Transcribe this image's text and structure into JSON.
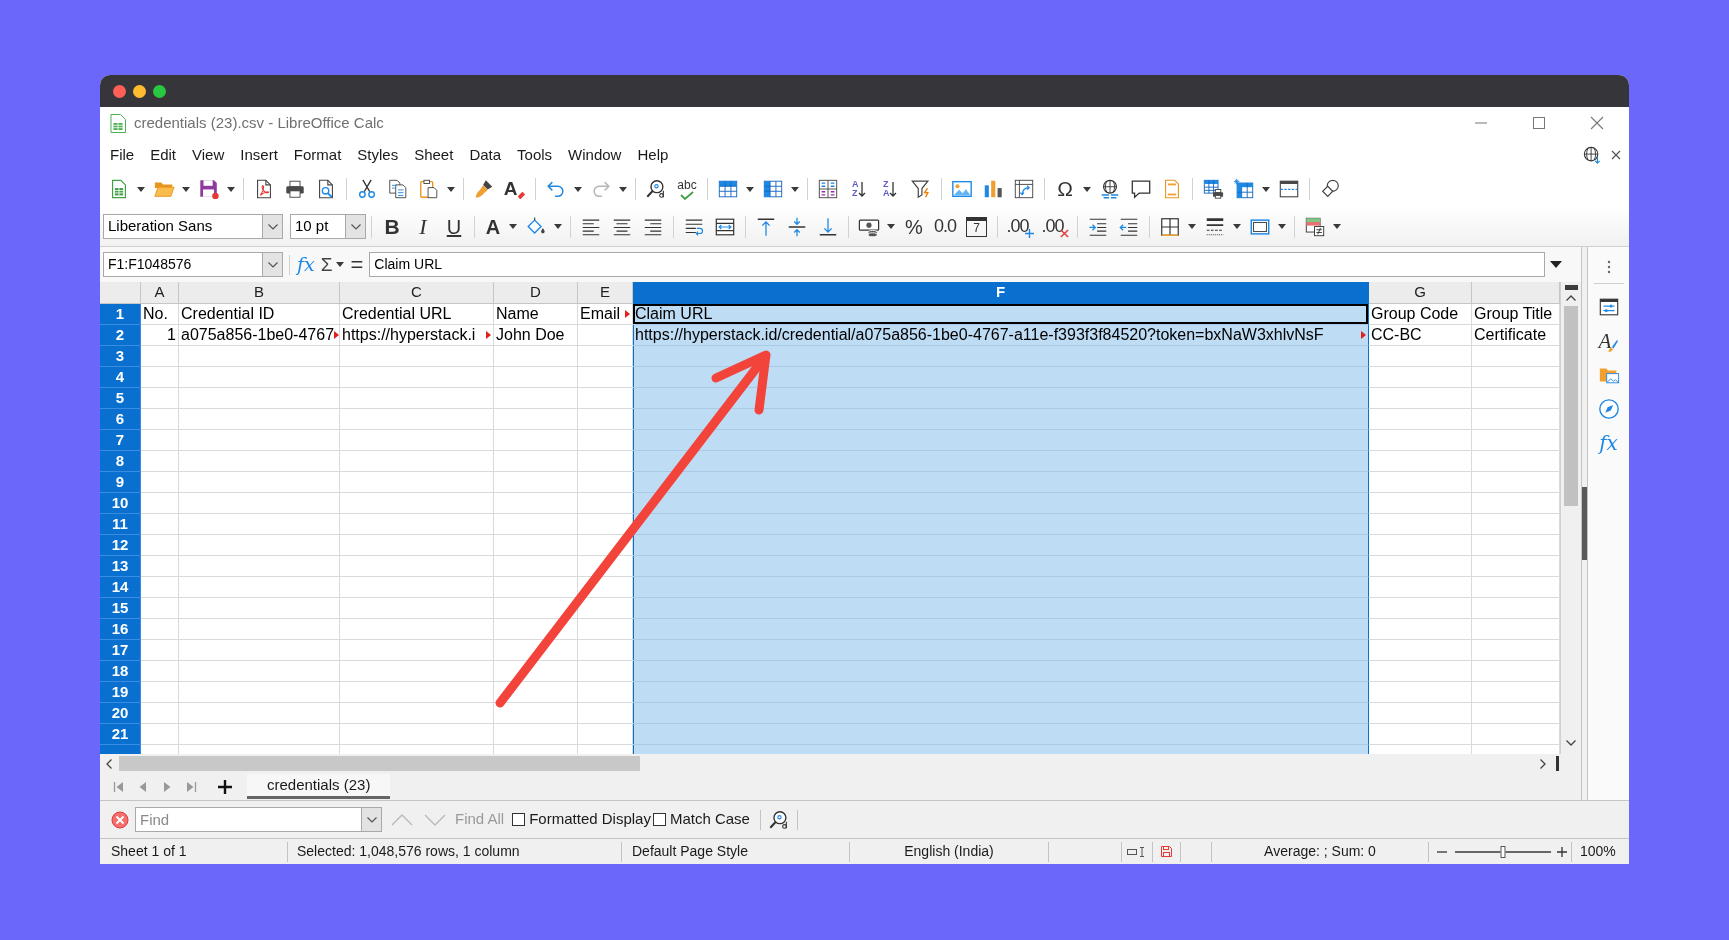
{
  "window": {
    "title": "credentials (23).csv - LibreOffice Calc"
  },
  "menu": [
    "File",
    "Edit",
    "View",
    "Insert",
    "Format",
    "Styles",
    "Sheet",
    "Data",
    "Tools",
    "Window",
    "Help"
  ],
  "standard_toolbar": [
    [
      {
        "kind": "new",
        "dropdown": true,
        "disabled": false
      },
      {
        "kind": "open",
        "dropdown": true,
        "disabled": false
      },
      {
        "kind": "save",
        "dropdown": true,
        "disabled": false
      }
    ],
    [
      {
        "kind": "export_pdf",
        "dropdown": false,
        "disabled": false
      },
      {
        "kind": "print",
        "dropdown": false,
        "disabled": false
      },
      {
        "kind": "print_preview",
        "dropdown": false,
        "disabled": false
      }
    ],
    [
      {
        "kind": "cut",
        "dropdown": false,
        "disabled": false
      },
      {
        "kind": "copy",
        "dropdown": false,
        "disabled": false
      },
      {
        "kind": "paste",
        "dropdown": true,
        "disabled": false
      }
    ],
    [
      {
        "kind": "clone",
        "dropdown": false,
        "disabled": false
      },
      {
        "kind": "clear_formatting",
        "label": "A",
        "dropdown": false,
        "disabled": false
      }
    ],
    [
      {
        "kind": "undo",
        "dropdown": true,
        "disabled": false
      },
      {
        "kind": "redo",
        "dropdown": true,
        "disabled": true
      }
    ],
    [
      {
        "kind": "find_replace",
        "dropdown": false,
        "disabled": false
      },
      {
        "kind": "spelling",
        "label": "abc",
        "dropdown": false,
        "disabled": false
      }
    ],
    [
      {
        "kind": "row",
        "dropdown": true,
        "disabled": false
      },
      {
        "kind": "column",
        "dropdown": true,
        "disabled": false
      }
    ],
    [
      {
        "kind": "sort",
        "dropdown": false,
        "disabled": false
      },
      {
        "kind": "sort_ascending",
        "label": "AZ",
        "dropdown": false,
        "disabled": false
      },
      {
        "kind": "sort_descending",
        "label": "ZA",
        "dropdown": false,
        "disabled": false
      },
      {
        "kind": "autofilter",
        "dropdown": false,
        "disabled": false
      }
    ],
    [
      {
        "kind": "image",
        "dropdown": false,
        "disabled": false
      },
      {
        "kind": "chart",
        "dropdown": false,
        "disabled": false
      },
      {
        "kind": "pivot_table",
        "dropdown": false,
        "disabled": false
      }
    ],
    [
      {
        "kind": "special_character",
        "label": "Ω",
        "dropdown": true,
        "disabled": false
      },
      {
        "kind": "hyperlink",
        "dropdown": false,
        "disabled": false
      },
      {
        "kind": "comment",
        "dropdown": false,
        "disabled": false
      },
      {
        "kind": "headers_footers",
        "dropdown": false,
        "disabled": false
      }
    ],
    [
      {
        "kind": "print_area",
        "dropdown": false,
        "disabled": false
      },
      {
        "kind": "freeze",
        "dropdown": true,
        "disabled": false
      },
      {
        "kind": "split_window",
        "dropdown": false,
        "disabled": false
      }
    ],
    [
      {
        "kind": "draw_functions",
        "dropdown": false,
        "disabled": false
      }
    ]
  ],
  "formatting_toolbar": {
    "font_name": "Liberation Sans",
    "font_size": "10 pt",
    "groups": [
      [
        {
          "kind": "bold",
          "label": "B",
          "dropdown": false
        },
        {
          "kind": "italic",
          "label": "I",
          "dropdown": false
        },
        {
          "kind": "underline",
          "label": "U",
          "dropdown": false
        }
      ],
      [
        {
          "kind": "font_color",
          "label": "A",
          "dropdown": true
        },
        {
          "kind": "highlight",
          "dropdown": true
        }
      ],
      [
        {
          "kind": "align_left",
          "dropdown": false
        },
        {
          "kind": "align_center",
          "dropdown": false
        },
        {
          "kind": "align_right",
          "dropdown": false
        }
      ],
      [
        {
          "kind": "wrap",
          "dropdown": false
        },
        {
          "kind": "merge",
          "dropdown": false
        }
      ],
      [
        {
          "kind": "align_top",
          "dropdown": false
        },
        {
          "kind": "align_middle",
          "dropdown": false
        },
        {
          "kind": "align_bottom",
          "dropdown": false
        }
      ],
      [
        {
          "kind": "currency",
          "dropdown": true
        },
        {
          "kind": "percent",
          "label": "%",
          "dropdown": false
        },
        {
          "kind": "number",
          "label": "0.0",
          "dropdown": false
        },
        {
          "kind": "date",
          "label": "7",
          "dropdown": false
        }
      ],
      [
        {
          "kind": "add_decimal",
          "label": ".00",
          "dropdown": false
        },
        {
          "kind": "delete_decimal",
          "label": ".00",
          "dropdown": false
        }
      ],
      [
        {
          "kind": "indent",
          "dropdown": false
        },
        {
          "kind": "unindent",
          "dropdown": false
        }
      ],
      [
        {
          "kind": "borders",
          "dropdown": true
        },
        {
          "kind": "border_style",
          "dropdown": true
        },
        {
          "kind": "border_color",
          "dropdown": true
        }
      ],
      [
        {
          "kind": "conditional",
          "dropdown": true
        }
      ]
    ]
  },
  "formula_bar": {
    "name_box": "F1:F1048576",
    "function_wizard": "fx",
    "sum": "Σ",
    "equals": "=",
    "content": "Claim URL"
  },
  "sheet": {
    "columns": [
      {
        "label": "A",
        "selected": false
      },
      {
        "label": "B",
        "selected": false
      },
      {
        "label": "C",
        "selected": false
      },
      {
        "label": "D",
        "selected": false
      },
      {
        "label": "E",
        "selected": false
      },
      {
        "label": "F",
        "selected": true
      },
      {
        "label": "G",
        "selected": false
      },
      {
        "selected": false
      }
    ],
    "rows": [
      {
        "label": "1",
        "selected": true,
        "cells": [
          {
            "text": "No.",
            "kind": "text",
            "clipped": false,
            "active": false
          },
          {
            "text": "Credential ID",
            "kind": "text",
            "clipped": false,
            "active": false
          },
          {
            "text": "Credential URL",
            "kind": "text",
            "clipped": false,
            "active": false
          },
          {
            "text": "Name",
            "kind": "text",
            "clipped": false,
            "active": false
          },
          {
            "text": "Email",
            "kind": "text",
            "clipped": true,
            "active": false
          },
          {
            "text": "Claim URL",
            "kind": "text",
            "clipped": false,
            "active": true
          },
          {
            "text": "Group Code",
            "kind": "text",
            "clipped": false,
            "active": false
          },
          {
            "text": "Group Title",
            "kind": "text",
            "clipped": false,
            "active": false
          }
        ]
      },
      {
        "label": "2",
        "selected": true,
        "cells": [
          {
            "text": "1",
            "kind": "number",
            "clipped": false,
            "active": false
          },
          {
            "text": "a075a856-1be0-4767",
            "kind": "text",
            "clipped": true,
            "active": false
          },
          {
            "text": "https://hyperstack.i",
            "kind": "text",
            "clipped": true,
            "active": false
          },
          {
            "text": "John Doe",
            "kind": "text",
            "clipped": false,
            "active": false
          },
          null,
          {
            "text": "https://hyperstack.id/credential/a075a856-1be0-4767-a11e-f393f3f84520?token=bxNaW3xhlvNsF",
            "kind": "text",
            "clipped": true,
            "active": false
          },
          {
            "text": "CC-BC",
            "kind": "text",
            "clipped": false,
            "active": false
          },
          {
            "text": "Certificate",
            "kind": "text",
            "clipped": false,
            "active": false
          }
        ]
      },
      {
        "label": "3",
        "selected": true
      },
      {
        "label": "4",
        "selected": true
      },
      {
        "label": "5",
        "selected": true
      },
      {
        "label": "6",
        "selected": true
      },
      {
        "label": "7",
        "selected": true
      },
      {
        "label": "8",
        "selected": true
      },
      {
        "label": "9",
        "selected": true
      },
      {
        "label": "10",
        "selected": true
      },
      {
        "label": "11",
        "selected": true
      },
      {
        "label": "12",
        "selected": true
      },
      {
        "label": "13",
        "selected": true
      },
      {
        "label": "14",
        "selected": true
      },
      {
        "label": "15",
        "selected": true
      },
      {
        "label": "16",
        "selected": true
      },
      {
        "label": "17",
        "selected": true
      },
      {
        "label": "18",
        "selected": true
      },
      {
        "label": "19",
        "selected": true
      },
      {
        "label": "20",
        "selected": true
      },
      {
        "label": "21",
        "selected": true
      }
    ]
  },
  "sheet_tabs": [
    {
      "label": "credentials (23)",
      "selected": true
    }
  ],
  "sidebar": [
    {
      "kind": "properties"
    },
    {
      "kind": "styles",
      "label": "A"
    },
    {
      "kind": "gallery"
    },
    {
      "kind": "navigator"
    },
    {
      "kind": "functions",
      "label": "fx"
    }
  ],
  "find_bar": {
    "placeholder": "Find",
    "previous": {
      "disabled": true
    },
    "next": {
      "disabled": true
    },
    "find_all": {
      "label": "Find All",
      "disabled": true
    },
    "options": [
      {
        "label": "Formatted Display",
        "checked": false
      },
      {
        "label": "Match Case",
        "checked": false
      }
    ]
  },
  "status_bar": {
    "sheet": "Sheet 1 of 1",
    "selection": "Selected: 1,048,576 rows, 1 column",
    "page_style": "Default Page Style",
    "language": "English (India)",
    "document_modified": true,
    "summary": "Average: ; Sum: 0",
    "zoom": {
      "level": 0.5,
      "reading": "100%"
    }
  }
}
